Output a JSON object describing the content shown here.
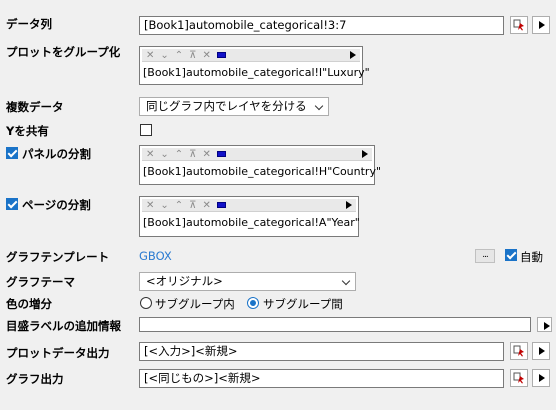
{
  "rows": {
    "data_series": {
      "label": "データ列",
      "value": "[Book1]automobile_categorical!3:7"
    },
    "plot_group": {
      "label": "プロットをグループ化",
      "value": "[Book1]automobile_categorical!I\"Luxury\""
    },
    "multi_data": {
      "label": "複数データ",
      "value": "同じグラフ内でレイヤを分ける"
    },
    "share_y": {
      "label": "Yを共有"
    },
    "panel_split": {
      "label": "パネルの分割",
      "value": "[Book1]automobile_categorical!H\"Country\""
    },
    "page_split": {
      "label": "ページの分割",
      "value": "[Book1]automobile_categorical!A\"Year\""
    },
    "graph_template": {
      "label": "グラフテンプレート",
      "value": "GBOX",
      "more": "...",
      "auto_label": "自動"
    },
    "graph_theme": {
      "label": "グラフテーマ",
      "value": "<オリジナル>"
    },
    "color_increment": {
      "label": "色の増分",
      "option1": "サブグループ内",
      "option2": "サブグループ間"
    },
    "tick_label_info": {
      "label": "目盛ラベルの追加情報",
      "value": ""
    },
    "plot_data_output": {
      "label": "プロットデータ出力",
      "value": "[<入力>]<新規>"
    },
    "graph_output": {
      "label": "グラフ出力",
      "value": "[<同じもの>]<新規>"
    }
  },
  "group_toolbar": {
    "icons": [
      "remove-down-icon",
      "move-down-icon",
      "move-up-icon",
      "move-top-icon",
      "delete-icon",
      "color-block-icon",
      "expand-arrow-icon"
    ]
  },
  "colors": {
    "accent": "#1a73c8",
    "link": "#2b7bd1"
  }
}
